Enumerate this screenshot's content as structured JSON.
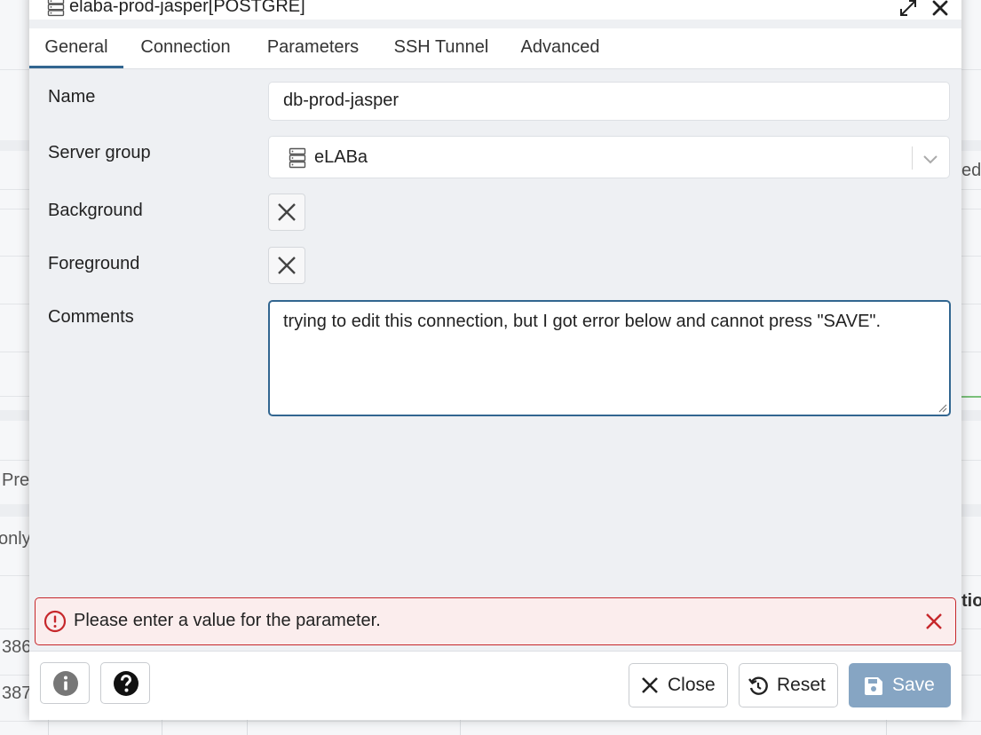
{
  "background": {
    "fragments": [
      "ed",
      "Pre",
      "only",
      "tio",
      "386",
      "387"
    ]
  },
  "dialog": {
    "title": "elaba-prod-jasper[POSTGRE]",
    "tabs": [
      {
        "label": "General"
      },
      {
        "label": "Connection"
      },
      {
        "label": "Parameters"
      },
      {
        "label": "SSH Tunnel"
      },
      {
        "label": "Advanced"
      }
    ],
    "active_tab": "General",
    "form": {
      "name_label": "Name",
      "name_value": "db-prod-jasper",
      "server_group_label": "Server group",
      "server_group_value": "eLABa",
      "background_label": "Background",
      "foreground_label": "Foreground",
      "comments_label": "Comments",
      "comments_value": "trying to edit this connection, but I got error below and cannot press \"SAVE\"."
    },
    "error": {
      "message": "Please enter a value for the parameter.",
      "color": "#c6272b"
    },
    "footer": {
      "close_label": "Close",
      "reset_label": "Reset",
      "save_label": "Save"
    },
    "colors": {
      "accent": "#326690",
      "save_disabled": "#86a5c3"
    },
    "icons": [
      "server-icon",
      "expand-icon",
      "close-icon",
      "chevron-down-icon",
      "x-icon",
      "alert-circle-icon",
      "info-icon",
      "help-icon",
      "reset-icon",
      "save-icon"
    ]
  }
}
